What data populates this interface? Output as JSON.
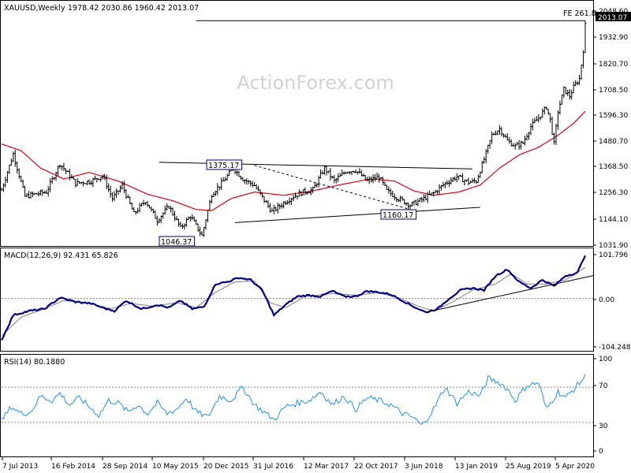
{
  "watermark": "ActionForex.com",
  "chart_data": [
    {
      "type": "candlestick",
      "title": "XAUUSD,Weekly",
      "ohlc_text": "1978.42 2030.86 1960.42 2013.07",
      "last_price_label": "2013.07",
      "y_axis_ticks": [
        "2048.60",
        "1932.90",
        "1820.70",
        "1708.50",
        "1596.30",
        "1480.70",
        "1368.50",
        "1256.30",
        "1144.10",
        "1031.90"
      ],
      "x_axis_labels": [
        "7 Jul 2013",
        "16 Feb 2014",
        "28 Sep 2014",
        "10 May 2015",
        "20 Dec 2015",
        "31 Jul 2016",
        "12 Mar 2017",
        "22 Oct 2017",
        "3 Jun 2018",
        "13 Jan 2019",
        "25 Aug 2019",
        "5 Apr 2020"
      ],
      "annotations": [
        "1375.17",
        "1160.17",
        "1046.37",
        "FE 261.8"
      ],
      "ma_color": "#e0000f",
      "price_color": "#000000",
      "anchors": [
        {
          "x": 0,
          "y": 1260
        },
        {
          "x": 6,
          "y": 1425
        },
        {
          "x": 12,
          "y": 1230
        },
        {
          "x": 17,
          "y": 1240
        },
        {
          "x": 23,
          "y": 1250
        },
        {
          "x": 30,
          "y": 1380
        },
        {
          "x": 38,
          "y": 1290
        },
        {
          "x": 46,
          "y": 1300
        },
        {
          "x": 52,
          "y": 1325
        },
        {
          "x": 57,
          "y": 1220
        },
        {
          "x": 62,
          "y": 1280
        },
        {
          "x": 68,
          "y": 1150
        },
        {
          "x": 74,
          "y": 1210
        },
        {
          "x": 80,
          "y": 1120
        },
        {
          "x": 86,
          "y": 1185
        },
        {
          "x": 92,
          "y": 1085
        },
        {
          "x": 97,
          "y": 1140
        },
        {
          "x": 103,
          "y": 1050
        },
        {
          "x": 108,
          "y": 1240
        },
        {
          "x": 114,
          "y": 1300
        },
        {
          "x": 119,
          "y": 1360
        },
        {
          "x": 124,
          "y": 1310
        },
        {
          "x": 130,
          "y": 1280
        },
        {
          "x": 134,
          "y": 1225
        },
        {
          "x": 139,
          "y": 1160
        },
        {
          "x": 145,
          "y": 1200
        },
        {
          "x": 150,
          "y": 1230
        },
        {
          "x": 155,
          "y": 1250
        },
        {
          "x": 160,
          "y": 1260
        },
        {
          "x": 166,
          "y": 1360
        },
        {
          "x": 171,
          "y": 1300
        },
        {
          "x": 177,
          "y": 1345
        },
        {
          "x": 182,
          "y": 1350
        },
        {
          "x": 188,
          "y": 1300
        },
        {
          "x": 194,
          "y": 1320
        },
        {
          "x": 198,
          "y": 1255
        },
        {
          "x": 204,
          "y": 1220
        },
        {
          "x": 210,
          "y": 1190
        },
        {
          "x": 216,
          "y": 1215
        },
        {
          "x": 222,
          "y": 1245
        },
        {
          "x": 228,
          "y": 1290
        },
        {
          "x": 234,
          "y": 1320
        },
        {
          "x": 240,
          "y": 1295
        },
        {
          "x": 244,
          "y": 1300
        },
        {
          "x": 248,
          "y": 1400
        },
        {
          "x": 252,
          "y": 1510
        },
        {
          "x": 256,
          "y": 1540
        },
        {
          "x": 260,
          "y": 1485
        },
        {
          "x": 264,
          "y": 1460
        },
        {
          "x": 268,
          "y": 1475
        },
        {
          "x": 272,
          "y": 1550
        },
        {
          "x": 276,
          "y": 1590
        },
        {
          "x": 280,
          "y": 1640
        },
        {
          "x": 282,
          "y": 1580
        },
        {
          "x": 284,
          "y": 1470
        },
        {
          "x": 286,
          "y": 1620
        },
        {
          "x": 289,
          "y": 1720
        },
        {
          "x": 292,
          "y": 1690
        },
        {
          "x": 294,
          "y": 1730
        },
        {
          "x": 297,
          "y": 1770
        },
        {
          "x": 299,
          "y": 1900
        },
        {
          "x": 300,
          "y": 2013
        }
      ],
      "ma_anchors": [
        {
          "x": 0,
          "y": 1470
        },
        {
          "x": 10,
          "y": 1440
        },
        {
          "x": 20,
          "y": 1360
        },
        {
          "x": 32,
          "y": 1310
        },
        {
          "x": 45,
          "y": 1340
        },
        {
          "x": 60,
          "y": 1300
        },
        {
          "x": 75,
          "y": 1240
        },
        {
          "x": 88,
          "y": 1210
        },
        {
          "x": 100,
          "y": 1170
        },
        {
          "x": 108,
          "y": 1165
        },
        {
          "x": 118,
          "y": 1220
        },
        {
          "x": 130,
          "y": 1250
        },
        {
          "x": 145,
          "y": 1235
        },
        {
          "x": 160,
          "y": 1255
        },
        {
          "x": 175,
          "y": 1285
        },
        {
          "x": 190,
          "y": 1310
        },
        {
          "x": 202,
          "y": 1300
        },
        {
          "x": 212,
          "y": 1255
        },
        {
          "x": 222,
          "y": 1235
        },
        {
          "x": 235,
          "y": 1250
        },
        {
          "x": 246,
          "y": 1282
        },
        {
          "x": 256,
          "y": 1360
        },
        {
          "x": 266,
          "y": 1420
        },
        {
          "x": 276,
          "y": 1455
        },
        {
          "x": 286,
          "y": 1510
        },
        {
          "x": 294,
          "y": 1565
        },
        {
          "x": 300,
          "y": 1620
        }
      ],
      "trendlines": [
        {
          "x1": 81,
          "y1": 1386,
          "x2": 242,
          "y2": 1356,
          "style": "solid"
        },
        {
          "x1": 120,
          "y1": 1110,
          "x2": 246,
          "y2": 1180,
          "style": "solid"
        },
        {
          "x1": 130,
          "y1": 1372,
          "x2": 210,
          "y2": 1170,
          "style": "dashed"
        },
        {
          "x1": 100,
          "y1": 2035,
          "x2": 300,
          "y2": 2035,
          "style": "solid"
        }
      ],
      "ylim": [
        1010,
        2065
      ],
      "xlim": [
        0,
        300
      ]
    },
    {
      "type": "line",
      "title": "MACD(12,26,9) 92.431 65.826",
      "y_axis_ticks": [
        "101.796",
        "0.00",
        "-104.248"
      ],
      "macd_color": "#00008b",
      "signal_color": "#808080",
      "macd_anchors": [
        {
          "x": 0,
          "y": -100
        },
        {
          "x": 6,
          "y": -40
        },
        {
          "x": 14,
          "y": -30
        },
        {
          "x": 22,
          "y": -25
        },
        {
          "x": 30,
          "y": 2
        },
        {
          "x": 38,
          "y": -8
        },
        {
          "x": 46,
          "y": -12
        },
        {
          "x": 52,
          "y": -22
        },
        {
          "x": 58,
          "y": -30
        },
        {
          "x": 64,
          "y": -5
        },
        {
          "x": 72,
          "y": -25
        },
        {
          "x": 80,
          "y": -15
        },
        {
          "x": 86,
          "y": -22
        },
        {
          "x": 92,
          "y": -5
        },
        {
          "x": 98,
          "y": -25
        },
        {
          "x": 104,
          "y": -20
        },
        {
          "x": 110,
          "y": 35
        },
        {
          "x": 116,
          "y": 40
        },
        {
          "x": 122,
          "y": 50
        },
        {
          "x": 128,
          "y": 45
        },
        {
          "x": 134,
          "y": 20
        },
        {
          "x": 140,
          "y": -40
        },
        {
          "x": 146,
          "y": -15
        },
        {
          "x": 152,
          "y": 5
        },
        {
          "x": 158,
          "y": 8
        },
        {
          "x": 164,
          "y": 5
        },
        {
          "x": 170,
          "y": 18
        },
        {
          "x": 176,
          "y": 5
        },
        {
          "x": 182,
          "y": 5
        },
        {
          "x": 188,
          "y": 18
        },
        {
          "x": 194,
          "y": 15
        },
        {
          "x": 200,
          "y": 10
        },
        {
          "x": 206,
          "y": -5
        },
        {
          "x": 212,
          "y": -20
        },
        {
          "x": 218,
          "y": -33
        },
        {
          "x": 224,
          "y": -25
        },
        {
          "x": 230,
          "y": 0
        },
        {
          "x": 236,
          "y": 20
        },
        {
          "x": 242,
          "y": 25
        },
        {
          "x": 248,
          "y": 20
        },
        {
          "x": 254,
          "y": 55
        },
        {
          "x": 260,
          "y": 70
        },
        {
          "x": 266,
          "y": 40
        },
        {
          "x": 272,
          "y": 25
        },
        {
          "x": 278,
          "y": 45
        },
        {
          "x": 284,
          "y": 30
        },
        {
          "x": 290,
          "y": 55
        },
        {
          "x": 296,
          "y": 62
        },
        {
          "x": 300,
          "y": 105
        }
      ],
      "signal_anchors": [
        {
          "x": 0,
          "y": -90
        },
        {
          "x": 10,
          "y": -45
        },
        {
          "x": 20,
          "y": -28
        },
        {
          "x": 32,
          "y": -5
        },
        {
          "x": 44,
          "y": -10
        },
        {
          "x": 56,
          "y": -25
        },
        {
          "x": 66,
          "y": -12
        },
        {
          "x": 78,
          "y": -18
        },
        {
          "x": 90,
          "y": -10
        },
        {
          "x": 100,
          "y": -22
        },
        {
          "x": 110,
          "y": 15
        },
        {
          "x": 120,
          "y": 40
        },
        {
          "x": 130,
          "y": 42
        },
        {
          "x": 138,
          "y": -10
        },
        {
          "x": 146,
          "y": -22
        },
        {
          "x": 156,
          "y": 5
        },
        {
          "x": 170,
          "y": 12
        },
        {
          "x": 182,
          "y": 8
        },
        {
          "x": 194,
          "y": 14
        },
        {
          "x": 204,
          "y": 2
        },
        {
          "x": 214,
          "y": -18
        },
        {
          "x": 222,
          "y": -30
        },
        {
          "x": 232,
          "y": -8
        },
        {
          "x": 242,
          "y": 20
        },
        {
          "x": 254,
          "y": 35
        },
        {
          "x": 262,
          "y": 60
        },
        {
          "x": 270,
          "y": 35
        },
        {
          "x": 280,
          "y": 35
        },
        {
          "x": 290,
          "y": 45
        },
        {
          "x": 300,
          "y": 75
        }
      ],
      "trendline": {
        "x1": 218,
        "y1": -33,
        "x2": 300,
        "y2": 55
      },
      "ylim": [
        -120,
        115
      ],
      "xlim": [
        0,
        300
      ]
    },
    {
      "type": "line",
      "title": "RSI(14) 80.1880",
      "y_axis_ticks": [
        "100",
        "70",
        "30",
        "0"
      ],
      "rsi_color": "#1e90ff",
      "rsi_anchors": [
        {
          "x": 0,
          "y": 32
        },
        {
          "x": 5,
          "y": 48
        },
        {
          "x": 10,
          "y": 40
        },
        {
          "x": 15,
          "y": 42
        },
        {
          "x": 20,
          "y": 60
        },
        {
          "x": 26,
          "y": 55
        },
        {
          "x": 30,
          "y": 63
        },
        {
          "x": 35,
          "y": 50
        },
        {
          "x": 40,
          "y": 58
        },
        {
          "x": 45,
          "y": 48
        },
        {
          "x": 50,
          "y": 38
        },
        {
          "x": 55,
          "y": 55
        },
        {
          "x": 60,
          "y": 52
        },
        {
          "x": 65,
          "y": 42
        },
        {
          "x": 70,
          "y": 50
        },
        {
          "x": 75,
          "y": 40
        },
        {
          "x": 80,
          "y": 52
        },
        {
          "x": 85,
          "y": 40
        },
        {
          "x": 90,
          "y": 45
        },
        {
          "x": 95,
          "y": 58
        },
        {
          "x": 100,
          "y": 42
        },
        {
          "x": 106,
          "y": 36
        },
        {
          "x": 112,
          "y": 60
        },
        {
          "x": 118,
          "y": 55
        },
        {
          "x": 124,
          "y": 70
        },
        {
          "x": 130,
          "y": 50
        },
        {
          "x": 136,
          "y": 40
        },
        {
          "x": 140,
          "y": 33
        },
        {
          "x": 146,
          "y": 48
        },
        {
          "x": 152,
          "y": 52
        },
        {
          "x": 158,
          "y": 55
        },
        {
          "x": 164,
          "y": 65
        },
        {
          "x": 170,
          "y": 50
        },
        {
          "x": 176,
          "y": 60
        },
        {
          "x": 182,
          "y": 45
        },
        {
          "x": 188,
          "y": 58
        },
        {
          "x": 194,
          "y": 55
        },
        {
          "x": 200,
          "y": 50
        },
        {
          "x": 206,
          "y": 40
        },
        {
          "x": 212,
          "y": 35
        },
        {
          "x": 216,
          "y": 26
        },
        {
          "x": 222,
          "y": 45
        },
        {
          "x": 228,
          "y": 70
        },
        {
          "x": 234,
          "y": 52
        },
        {
          "x": 240,
          "y": 65
        },
        {
          "x": 246,
          "y": 60
        },
        {
          "x": 250,
          "y": 80
        },
        {
          "x": 256,
          "y": 75
        },
        {
          "x": 260,
          "y": 68
        },
        {
          "x": 264,
          "y": 55
        },
        {
          "x": 270,
          "y": 72
        },
        {
          "x": 276,
          "y": 75
        },
        {
          "x": 280,
          "y": 45
        },
        {
          "x": 286,
          "y": 65
        },
        {
          "x": 290,
          "y": 58
        },
        {
          "x": 295,
          "y": 70
        },
        {
          "x": 300,
          "y": 82
        }
      ],
      "levels": [
        70,
        30
      ],
      "ylim": [
        -5,
        105
      ],
      "xlim": [
        0,
        300
      ]
    }
  ]
}
